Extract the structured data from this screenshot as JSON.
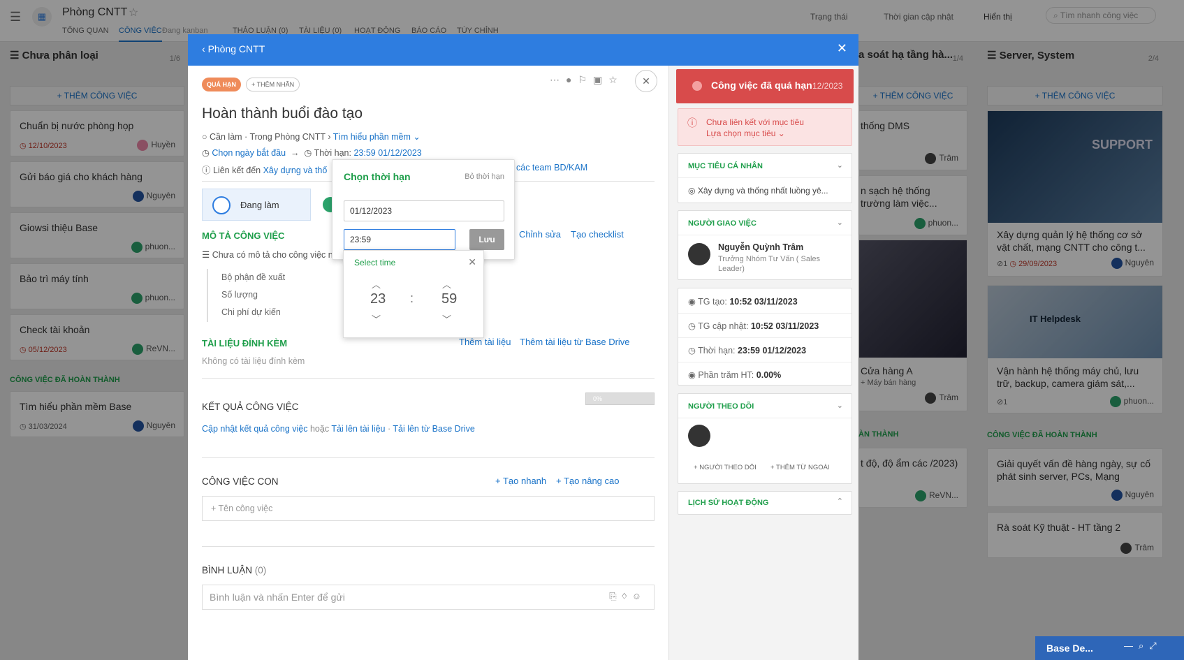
{
  "topbar": {
    "title": "Phòng CNTT",
    "tabs": [
      "TỔNG QUAN",
      "CÔNG VIỆC",
      "Đang kanban",
      "THẢO LUẬN (0)",
      "TÀI LIỆU (0)",
      "HOẠT ĐỘNG",
      "BÁO CÁO",
      "TÙY CHỈNH"
    ],
    "filters": [
      "Trạng thái",
      "Thời gian cập nhật",
      "Hiển thị"
    ],
    "search_placeholder": "Tìm nhanh công việc"
  },
  "col1": {
    "title": "Chưa phân loại",
    "count": "1/6",
    "add": "+ THÊM CÔNG VIỆC",
    "cards": [
      {
        "title": "Chuẩn bị nước phòng họp",
        "date": "12/10/2023",
        "user": "Huyền"
      },
      {
        "title": "Gửi báo giá cho khách hàng",
        "date": "",
        "user": "Nguyên"
      },
      {
        "title": "Giowsi thiệu Base",
        "date": "",
        "user": "phuon..."
      },
      {
        "title": "Bảo trì máy tính",
        "date": "",
        "user": "phuon..."
      },
      {
        "title": "Check tài khoản",
        "date": "05/12/2023",
        "user": "ReVN..."
      }
    ],
    "done_label": "CÔNG VIỆC ĐÃ HOÀN THÀNH",
    "done_card": {
      "title": "Tìm hiểu phần mềm Base",
      "date": "31/03/2024",
      "user": "Nguyên"
    }
  },
  "col3": {
    "title": "a soát hạ tầng hà...",
    "count": "1/4",
    "add": "+ THÊM CÔNG VIỆC",
    "cards": [
      {
        "title": "thống DMS",
        "user": "Trâm"
      },
      {
        "title": "n sạch hệ thống trường làm việc...",
        "user": "phuon..."
      },
      {
        "title": "Cửa hàng A",
        "sub": "+ Máy bán hàng",
        "user": "Trâm"
      }
    ],
    "done_label": "ÀN THÀNH",
    "done_card": {
      "title": "t độ, độ ẩm các /2023)",
      "user": "ReVN..."
    }
  },
  "col4": {
    "title": "Server, System",
    "count": "2/4",
    "add": "+ THÊM CÔNG VIỆC",
    "cards": [
      {
        "title": "Xây dựng quản lý hệ thống cơ sở vật chất, mạng CNTT cho công t...",
        "sub": "1",
        "date": "29/09/2023",
        "user": "Nguyên",
        "img": "SUPPORT"
      },
      {
        "title": "Vận hành hệ thống máy chủ, lưu trữ, backup, camera giám sát,...",
        "sub": "1",
        "user": "phuon...",
        "img": "IT Helpdesk"
      }
    ],
    "done_label": "CÔNG VIỆC ĐÃ HOÀN THÀNH",
    "done_cards": [
      {
        "title": "Giải quyết vấn đề hàng ngày, sự cố phát sinh server, PCs, Mạng",
        "user": "Nguyên"
      },
      {
        "title": "Rà soát Kỹ thuật - HT tầng 2",
        "user": "Trâm"
      }
    ]
  },
  "modal": {
    "header": "Phòng CNTT",
    "badge_overdue": "QUÁ HẠN",
    "badge_add": "+ THÊM NHÃN",
    "title": "Hoàn thành buổi đào tạo",
    "meta_status": "Cần làm · Trong Phòng CNTT",
    "meta_parent": "Tìm hiểu phần mềm",
    "start_label": "Chọn ngày bắt đầu",
    "deadline_label": "Thời hạn:",
    "deadline": "23:59 01/12/2023",
    "link_label": "Liên kết đến",
    "link_value": "Xây dựng và thố",
    "link_value2": "các team BD/KAM",
    "status_btn": "Đang làm",
    "desc_title": "MÔ TẢ CÔNG VIỆC",
    "desc_edit": "Chỉnh sửa",
    "desc_checklist": "Tạo checklist",
    "desc_empty": "Chưa có mô tả cho công việc nà",
    "fields": [
      "Bộ phận đề xuất",
      "Số lượng",
      "Chi phí dự kiến"
    ],
    "attach_title": "TÀI LIỆU ĐÍNH KÈM",
    "attach_add": "Thêm tài liệu",
    "attach_drive": "Thêm tài liệu từ Base Drive",
    "attach_empty": "Không có tài liệu đính kèm",
    "result_title": "KẾT QUẢ CÔNG VIỆC",
    "result_pct": "0%",
    "result_update": "Cập nhật kết quả công việc",
    "result_or": "hoặc",
    "result_upload": "Tải lên tài liệu",
    "result_drive": "Tải lên từ Base Drive",
    "sub_title": "CÔNG VIỆC CON",
    "sub_quick": "Tạo nhanh",
    "sub_adv": "Tạo nâng cao",
    "sub_placeholder": "Tên công việc",
    "comment_title": "BÌNH LUẬN",
    "comment_count": "(0)",
    "comment_placeholder": "Bình luận và nhấn Enter để gửi"
  },
  "right": {
    "overdue": "Công việc đã quá hạn",
    "overdue_date": "12/2023",
    "goal_warn": "Chưa liên kết với mục tiêu",
    "goal_pick": "Lựa chọn mục tiêu",
    "personal_title": "MỤC TIÊU CÁ NHÂN",
    "personal_item": "Xây dựng và thống nhất luồng yê...",
    "assigner_title": "NGƯỜI GIAO VIỆC",
    "assigner_name": "Nguyễn Quỳnh Trâm",
    "assigner_role": "Trưởng Nhóm Tư Vấn ( Sales Leader)",
    "created_label": "TG tạo:",
    "created": "10:52 03/11/2023",
    "updated_label": "TG cập nhật:",
    "updated": "10:52 03/11/2023",
    "due_label": "Thời hạn:",
    "due": "23:59 01/12/2023",
    "pct_label": "Phần trăm HT:",
    "pct": "0.00%",
    "followers_title": "NGƯỜI THEO DÕI",
    "followers_add": "NGƯỜI THEO DÕI",
    "followers_ext": "THÊM TỪ NGOÀI",
    "history_title": "LỊCH SỬ HOẠT ĐỘNG"
  },
  "popup": {
    "title": "Chọn thời hạn",
    "clear": "Bỏ thời hạn",
    "date": "01/12/2023",
    "time": "23:59",
    "save": "Lưu"
  },
  "timepicker": {
    "title": "Select time",
    "hour": "23",
    "minute": "59",
    "sep": ":"
  },
  "bottom": {
    "label": "Base De..."
  },
  "colors": {
    "blue": "#2e7de0",
    "green": "#1e9e4a",
    "red": "#d9534f",
    "overdue_badge": "#f0a070"
  }
}
